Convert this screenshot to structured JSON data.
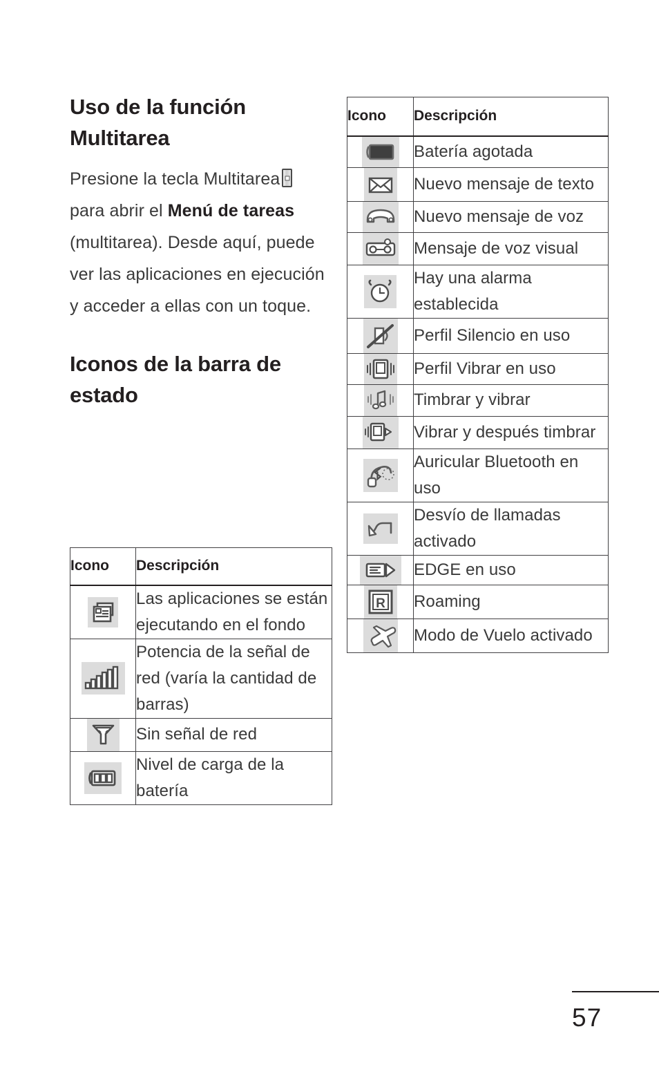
{
  "document": {
    "page_number": "57",
    "heading_1": "Uso de la función Multitarea",
    "heading_2": "Iconos de la barra de estado",
    "body": {
      "part_1": "Presione la tecla Multitarea",
      "key_icon": "multitask-key",
      "part_2": " para abrir el ",
      "bold_run": "Menú de tareas",
      "part_3": " (multitarea). Desde aquí, puede ver las aplicaciones en ejecución y acceder a ellas con un toque."
    }
  },
  "tables": {
    "status_bar_icons_left": {
      "headers": [
        "Icono",
        "Descripción"
      ],
      "rows": [
        {
          "icon": "running-apps-icon",
          "description": "Las aplicaciones se están ejecutando en el fondo"
        },
        {
          "icon": "signal-strength-icon",
          "description": "Potencia de la señal de red (varía la cantidad de barras)"
        },
        {
          "icon": "no-signal-icon",
          "description": "Sin señal de red"
        },
        {
          "icon": "battery-level-icon",
          "description": "Nivel de carga de la batería"
        }
      ]
    },
    "status_bar_icons_right": {
      "headers": [
        "Icono",
        "Descripción"
      ],
      "rows": [
        {
          "icon": "battery-empty-icon",
          "description": "Batería agotada"
        },
        {
          "icon": "new-text-message-icon",
          "description": "Nuevo mensaje de texto"
        },
        {
          "icon": "new-voice-message-icon",
          "description": "Nuevo mensaje de voz"
        },
        {
          "icon": "visual-voicemail-icon",
          "description": "Mensaje de voz visual"
        },
        {
          "icon": "alarm-clock-icon",
          "description": "Hay una alarma establecida"
        },
        {
          "icon": "silent-profile-icon",
          "description": "Perfil Silencio en uso"
        },
        {
          "icon": "vibrate-profile-icon",
          "description": "Perfil Vibrar en uso"
        },
        {
          "icon": "ring-and-vibrate-icon",
          "description": "Timbrar y vibrar"
        },
        {
          "icon": "vibrate-then-ring-icon",
          "description": "Vibrar y después timbrar"
        },
        {
          "icon": "bluetooth-headset-icon",
          "description": "Auricular Bluetooth en uso"
        },
        {
          "icon": "call-forwarding-icon",
          "description": "Desvío de llamadas activado"
        },
        {
          "icon": "edge-icon",
          "description": "EDGE en uso"
        },
        {
          "icon": "roaming-icon",
          "description": "Roaming"
        },
        {
          "icon": "airplane-mode-icon",
          "description": "Modo de Vuelo activado"
        }
      ]
    }
  },
  "colors": {
    "text": "#231f20",
    "body_text": "#3a3a3a",
    "rule": "#414042",
    "icon_chip_background": "#dcdcdc"
  }
}
